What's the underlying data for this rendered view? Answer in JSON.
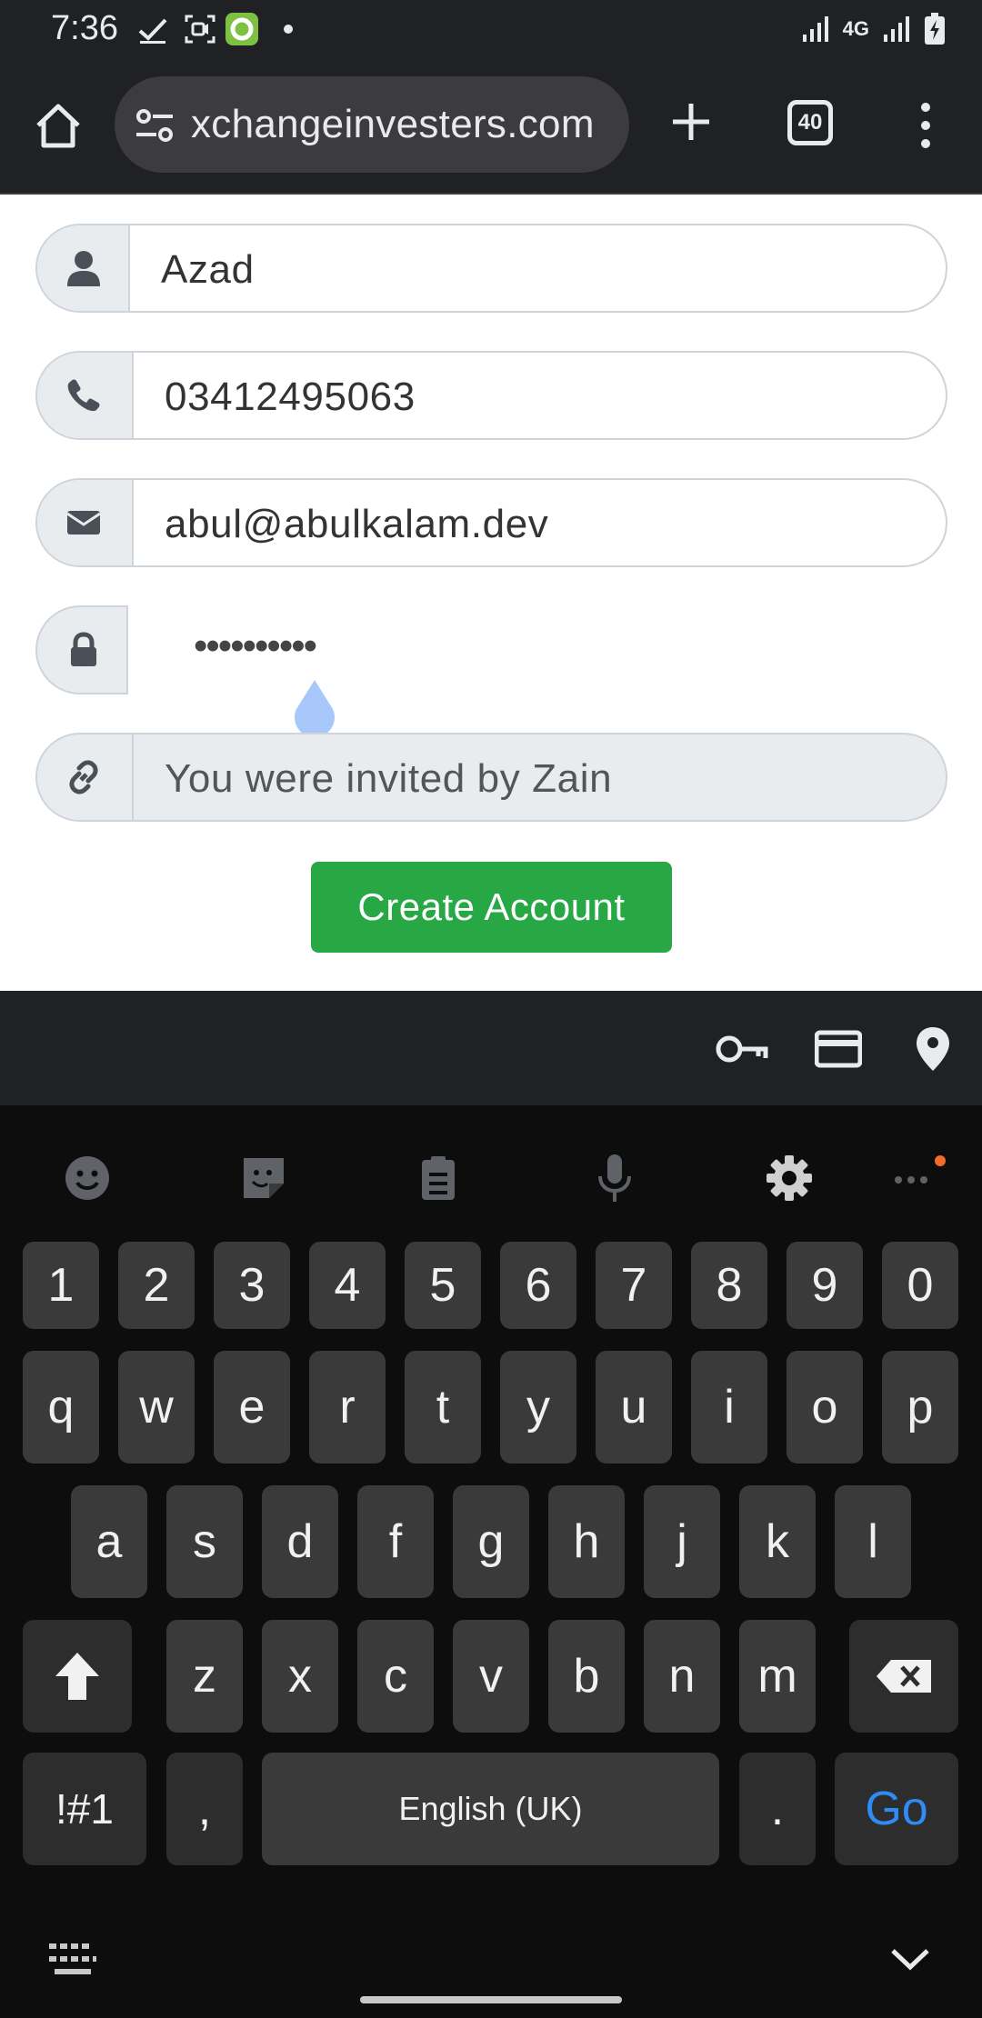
{
  "status_bar": {
    "time": "7:36",
    "network": "4G"
  },
  "browser": {
    "url": "xchangeinvesters.com",
    "tab_count": "40"
  },
  "form": {
    "name_value": "Azad",
    "phone_value": "03412495063",
    "email_value": "abul@abulkalam.dev",
    "password_mask": "••••••••••",
    "referral_value": "You were invited by Zain",
    "submit_label": "Create Account",
    "submit_color": "#28a745"
  },
  "keyboard": {
    "number_row": [
      "1",
      "2",
      "3",
      "4",
      "5",
      "6",
      "7",
      "8",
      "9",
      "0"
    ],
    "row1": [
      "q",
      "w",
      "e",
      "r",
      "t",
      "y",
      "u",
      "i",
      "o",
      "p"
    ],
    "row2": [
      "a",
      "s",
      "d",
      "f",
      "g",
      "h",
      "j",
      "k",
      "l"
    ],
    "row3": [
      "z",
      "x",
      "c",
      "v",
      "b",
      "n",
      "m"
    ],
    "symbols_key": "!#1",
    "comma_key": ",",
    "space_label": "English (UK)",
    "period_key": ".",
    "action_label": "Go",
    "action_color": "#2f8cf4"
  }
}
